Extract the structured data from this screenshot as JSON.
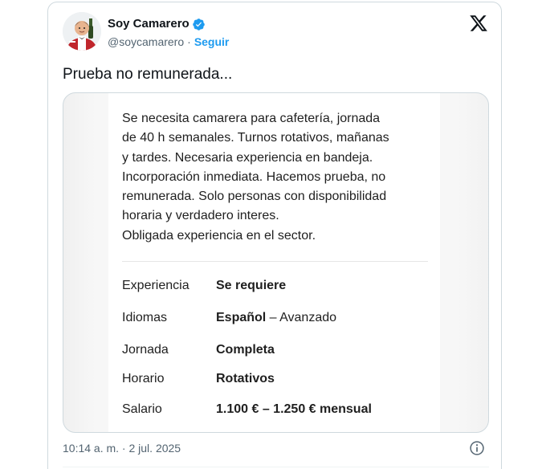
{
  "author": {
    "name": "Soy Camarero",
    "handle": "@soycamarero",
    "separator": "·",
    "follow_label": "Seguir"
  },
  "tweet": {
    "text": "Prueba no remunerada...",
    "timestamp": "10:14 a. m. · 2 jul. 2025"
  },
  "job_post": {
    "description": "Se necesita camarera para cafetería, jornada\nde 40 h semanales. Turnos rotativos, mañanas\ny tardes. Necesaria experiencia en bandeja.\nIncorporación inmediata. Hacemos prueba, no\nremunerada. Solo personas con disponibilidad\nhoraria y verdadero interes.\nObligada experiencia en el sector.",
    "details": [
      {
        "label": "Experiencia",
        "value": "Se requiere",
        "extra": ""
      },
      {
        "label": "Idiomas",
        "value": "Español",
        "extra": " – Avanzado"
      },
      {
        "label": "Jornada",
        "value": "Completa",
        "extra": ""
      },
      {
        "label": "Horario",
        "value": "Rotativos",
        "extra": ""
      },
      {
        "label": "Salario",
        "value": "1.100 € – 1.250 € mensual",
        "extra": ""
      }
    ]
  },
  "icons": {
    "verified": "verified-badge-icon",
    "platform": "x-logo-icon",
    "info": "info-icon"
  },
  "colors": {
    "accent": "#1d9bf0",
    "text_primary": "#0f1419",
    "text_secondary": "#536471",
    "border": "#cfd9de"
  }
}
